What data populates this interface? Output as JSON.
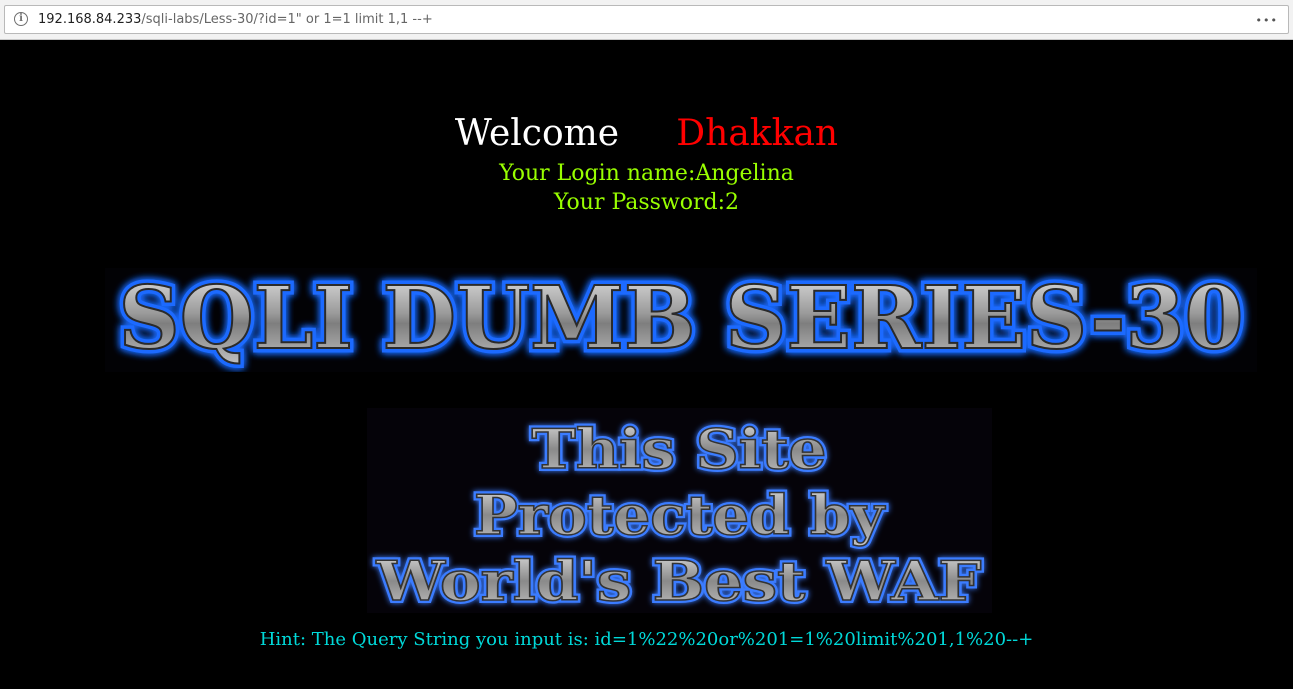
{
  "browser": {
    "url_host": "192.168.84.233",
    "url_path": "/sqli-labs/Less-30/?id=1\" or 1=1 limit 1,1 --+",
    "menu_label": "•••"
  },
  "page": {
    "welcome_word": "Welcome",
    "welcome_name": "Dhakkan",
    "login_line": "Your Login name:Angelina",
    "password_line": "Your Password:2",
    "banner_title": "SQLI DUMB SERIES-30",
    "waf_line1": "This Site",
    "waf_line2": "Protected by",
    "waf_line3": "World's Best WAF",
    "hint": "Hint: The Query String you input is: id=1%22%20or%201=1%20limit%201,1%20--+"
  },
  "colors": {
    "background": "#000000",
    "welcome": "#ffffff",
    "name": "#ff0000",
    "login": "#99ff00",
    "hint": "#00ffff",
    "banner_glow": "#1e6bff"
  },
  "icons": {
    "site_info": "info-icon",
    "page_menu": "menu-dots-icon"
  }
}
